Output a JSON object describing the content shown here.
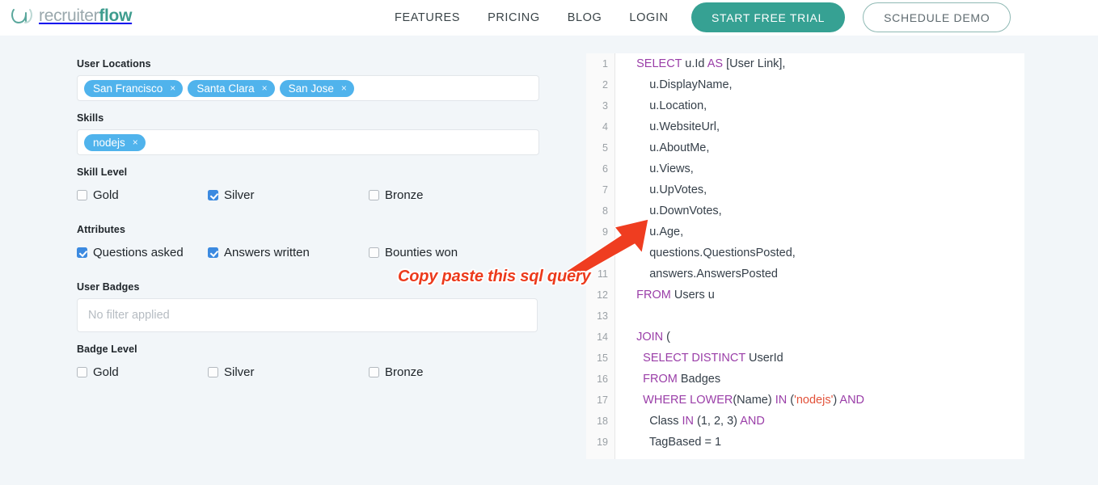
{
  "header": {
    "logo_text_light": "recruiter",
    "logo_text_bold": "flow",
    "nav": [
      {
        "label": "FEATURES"
      },
      {
        "label": "PRICING"
      },
      {
        "label": "BLOG"
      },
      {
        "label": "LOGIN"
      }
    ],
    "cta_primary": "START FREE TRIAL",
    "cta_secondary": "SCHEDULE DEMO",
    "brand_color": "#36a193"
  },
  "filters": {
    "user_locations": {
      "label": "User Locations",
      "tags": [
        "San Francisco",
        "Santa Clara",
        "San Jose"
      ],
      "remove_glyph": "×"
    },
    "skills": {
      "label": "Skills",
      "tags": [
        "nodejs"
      ],
      "remove_glyph": "×"
    },
    "skill_level": {
      "label": "Skill Level",
      "options": [
        {
          "label": "Gold",
          "checked": false
        },
        {
          "label": "Silver",
          "checked": true
        },
        {
          "label": "Bronze",
          "checked": false
        }
      ]
    },
    "attributes": {
      "label": "Attributes",
      "options": [
        {
          "label": "Questions asked",
          "checked": true
        },
        {
          "label": "Answers written",
          "checked": true
        },
        {
          "label": "Bounties won",
          "checked": false
        }
      ]
    },
    "user_badges": {
      "label": "User Badges",
      "value": "",
      "placeholder": "No filter applied"
    },
    "badge_level": {
      "label": "Badge Level",
      "options": [
        {
          "label": "Gold",
          "checked": false
        },
        {
          "label": "Silver",
          "checked": false
        },
        {
          "label": "Bronze",
          "checked": false
        }
      ]
    },
    "tag_color": "#50b3ec",
    "checkbox_color": "#3c8ae0"
  },
  "annotation": {
    "text": "Copy paste this sql query",
    "color": "#ec3a1c",
    "arrow": "red-arrow-pointing-up-right"
  },
  "code_panel": {
    "language": "sql",
    "keyword_color": "#9a3ea8",
    "string_color": "#e2523a",
    "line_numbers": [
      1,
      2,
      3,
      4,
      5,
      6,
      7,
      8,
      9,
      10,
      11,
      12,
      13,
      14,
      15,
      16,
      17,
      18,
      19
    ],
    "lines": [
      {
        "n": 1,
        "html": "    <span class=\"kw\">SELECT</span> u.Id <span class=\"kw\">AS</span> [User Link],"
      },
      {
        "n": 2,
        "html": "        u.DisplayName,"
      },
      {
        "n": 3,
        "html": "        u.Location,"
      },
      {
        "n": 4,
        "html": "        u.WebsiteUrl,"
      },
      {
        "n": 5,
        "html": "        u.AboutMe,"
      },
      {
        "n": 6,
        "html": "        u.Views,"
      },
      {
        "n": 7,
        "html": "        u.UpVotes,"
      },
      {
        "n": 8,
        "html": "        u.DownVotes,"
      },
      {
        "n": 9,
        "html": "        u.Age,"
      },
      {
        "n": 10,
        "html": "        questions.QuestionsPosted,"
      },
      {
        "n": 11,
        "html": "        answers.AnswersPosted"
      },
      {
        "n": 12,
        "html": "    <span class=\"kw\">FROM</span> Users u"
      },
      {
        "n": 13,
        "html": ""
      },
      {
        "n": 14,
        "html": "    <span class=\"kw\">JOIN</span> ("
      },
      {
        "n": 15,
        "html": "      <span class=\"kw\">SELECT DISTINCT</span> UserId"
      },
      {
        "n": 16,
        "html": "      <span class=\"kw\">FROM</span> Badges"
      },
      {
        "n": 17,
        "html": "      <span class=\"kw\">WHERE LOWER</span>(Name) <span class=\"kw\">IN</span> (<span class=\"str\">'nodejs'</span>) <span class=\"kw\">AND</span>"
      },
      {
        "n": 18,
        "html": "        Class <span class=\"kw\">IN</span> (1, 2, 3) <span class=\"kw\">AND</span>"
      },
      {
        "n": 19,
        "html": "        TagBased = 1"
      }
    ],
    "plain_text": "SELECT u.Id AS [User Link],\n        u.DisplayName,\n        u.Location,\n        u.WebsiteUrl,\n        u.AboutMe,\n        u.Views,\n        u.UpVotes,\n        u.DownVotes,\n        u.Age,\n        questions.QuestionsPosted,\n        answers.AnswersPosted\nFROM Users u\n\nJOIN (\n  SELECT DISTINCT UserId\n  FROM Badges\n  WHERE LOWER(Name) IN ('nodejs') AND\n    Class IN (1, 2, 3) AND\n    TagBased = 1"
  }
}
